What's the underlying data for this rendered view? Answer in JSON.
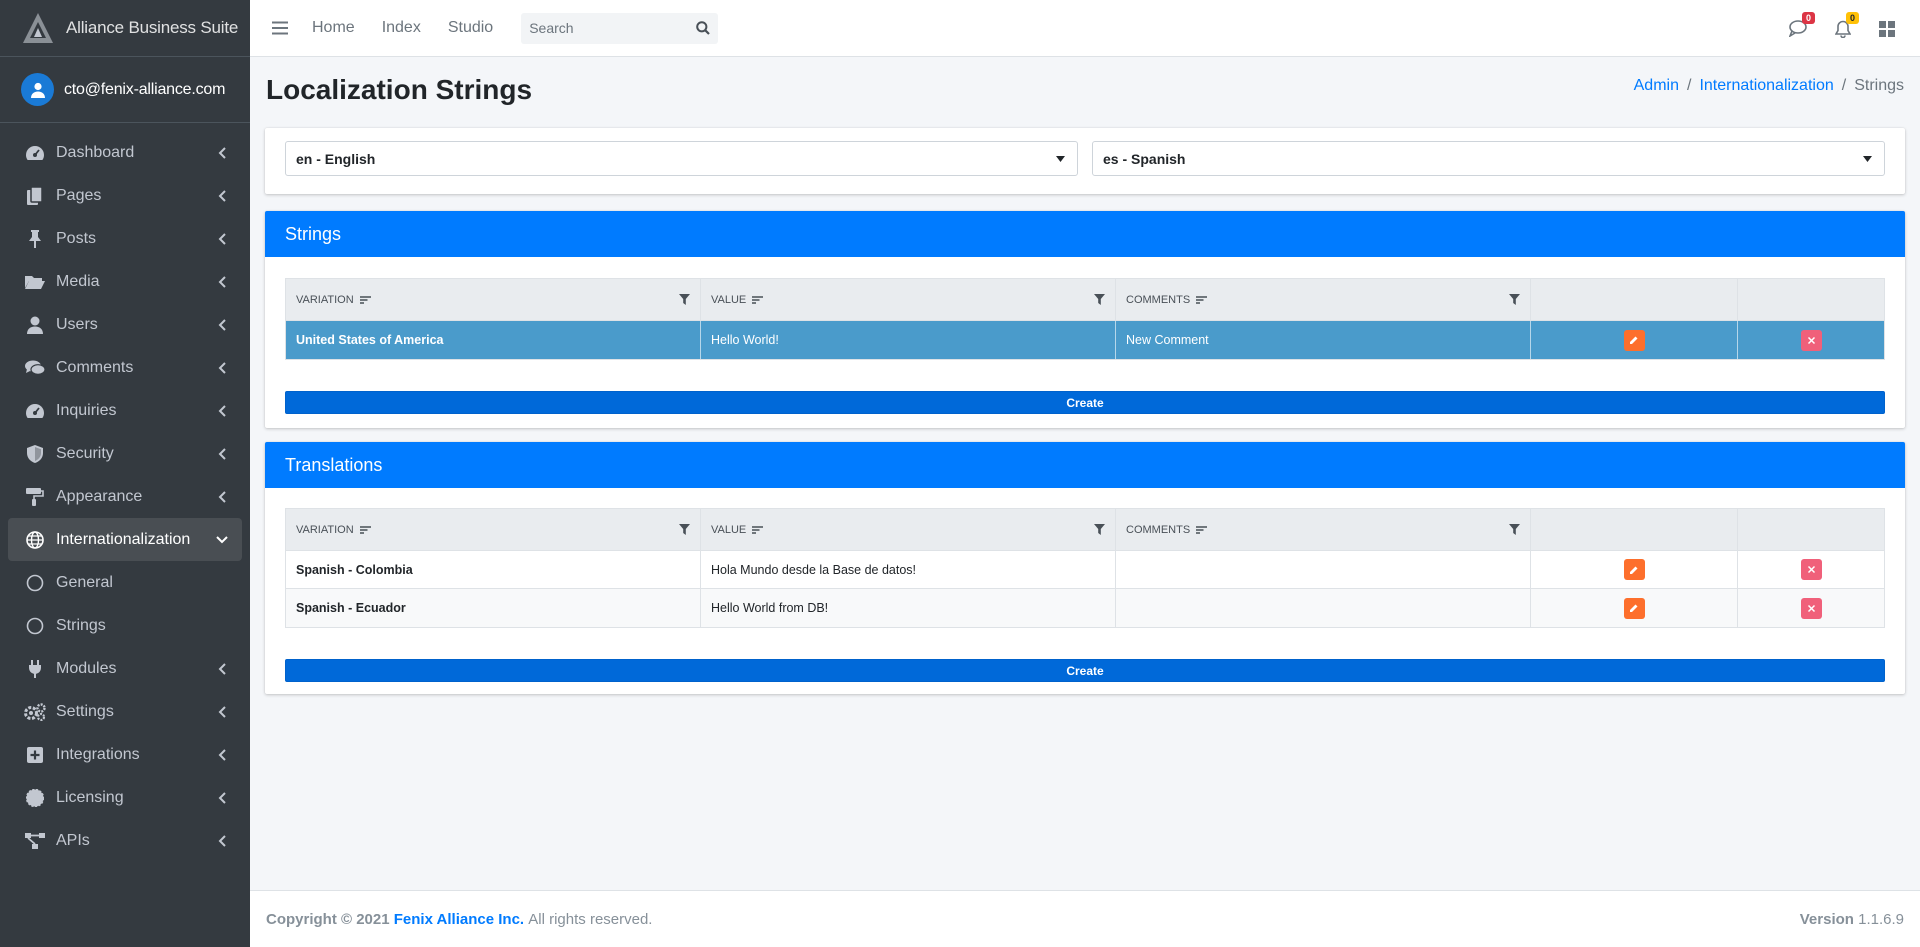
{
  "brand": {
    "title": "Alliance Business Suite"
  },
  "user": {
    "email": "cto@fenix-alliance.com"
  },
  "sidebar": {
    "items": [
      {
        "label": "Dashboard",
        "icon": "dashboard-gauge-icon"
      },
      {
        "label": "Pages",
        "icon": "copy-icon"
      },
      {
        "label": "Posts",
        "icon": "thumbtack-icon"
      },
      {
        "label": "Media",
        "icon": "folder-open-icon"
      },
      {
        "label": "Users",
        "icon": "user-icon"
      },
      {
        "label": "Comments",
        "icon": "comments-icon"
      },
      {
        "label": "Inquiries",
        "icon": "gauge-icon"
      },
      {
        "label": "Security",
        "icon": "shield-icon"
      },
      {
        "label": "Appearance",
        "icon": "paint-roller-icon"
      },
      {
        "label": "Internationalization",
        "icon": "globe-icon"
      },
      {
        "label": "General",
        "icon": "circle-icon"
      },
      {
        "label": "Strings",
        "icon": "circle-icon"
      },
      {
        "label": "Modules",
        "icon": "plug-icon"
      },
      {
        "label": "Settings",
        "icon": "cogs-icon"
      },
      {
        "label": "Integrations",
        "icon": "plus-square-icon"
      },
      {
        "label": "Licensing",
        "icon": "certificate-icon"
      },
      {
        "label": "APIs",
        "icon": "project-diagram-icon"
      }
    ]
  },
  "topbar": {
    "links": [
      "Home",
      "Index",
      "Studio"
    ],
    "search_placeholder": "Search",
    "messages_count": "0",
    "notifications_count": "0"
  },
  "page": {
    "title": "Localization Strings",
    "breadcrumb": {
      "root": "Admin",
      "section": "Internationalization",
      "current": "Strings"
    }
  },
  "language_select": {
    "source": "en - English",
    "target": "es - Spanish"
  },
  "strings_card": {
    "title": "Strings",
    "columns": [
      "VARIATION",
      "VALUE",
      "COMMENTS"
    ],
    "rows": [
      {
        "variation": "United States of America",
        "value": "Hello World!",
        "comments": "New Comment"
      }
    ],
    "create_label": "Create"
  },
  "translations_card": {
    "title": "Translations",
    "columns": [
      "VARIATION",
      "VALUE",
      "COMMENTS"
    ],
    "rows": [
      {
        "variation": "Spanish - Colombia",
        "value": "Hola Mundo desde la Base de datos!",
        "comments": ""
      },
      {
        "variation": "Spanish - Ecuador",
        "value": "Hello World from DB!",
        "comments": ""
      }
    ],
    "create_label": "Create"
  },
  "footer": {
    "copyright": "Copyright © 2021",
    "company": "Fenix Alliance Inc.",
    "rights": "All rights reserved.",
    "version_label": "Version",
    "version": "1.1.6.9"
  },
  "colors": {
    "primary": "#007bff",
    "sidebar_bg": "#343a40",
    "edit": "#fd6f2c",
    "delete": "#f0607a",
    "selected_row": "#4a9bcb"
  }
}
